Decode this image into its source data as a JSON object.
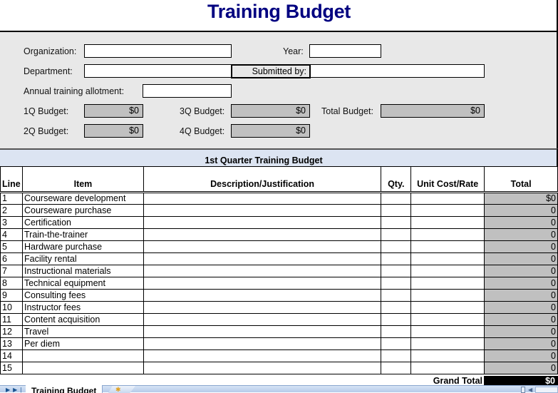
{
  "title": "Training Budget",
  "form": {
    "organization_label": "Organization:",
    "organization_value": "",
    "year_label": "Year:",
    "year_value": "",
    "department_label": "Department:",
    "department_value": "",
    "submitted_by_label": "Submitted by:",
    "submitted_by_value": "",
    "annual_allotment_label": "Annual training allotment:",
    "annual_allotment_value": "",
    "q1_label": "1Q Budget:",
    "q1_value": "$0",
    "q2_label": "2Q Budget:",
    "q2_value": "$0",
    "q3_label": "3Q Budget:",
    "q3_value": "$0",
    "q4_label": "4Q Budget:",
    "q4_value": "$0",
    "total_label": "Total Budget:",
    "total_value": "$0"
  },
  "quarter_section": {
    "title": "1st Quarter Training Budget",
    "columns": [
      "Line",
      "Item",
      "Description/Justification",
      "Qty.",
      "Unit Cost/Rate",
      "Total"
    ],
    "rows": [
      {
        "line": "1",
        "item": "Courseware development",
        "desc": "",
        "qty": "",
        "unit": "",
        "total": "$0"
      },
      {
        "line": "2",
        "item": "Courseware purchase",
        "desc": "",
        "qty": "",
        "unit": "",
        "total": "0"
      },
      {
        "line": "3",
        "item": "Certification",
        "desc": "",
        "qty": "",
        "unit": "",
        "total": "0"
      },
      {
        "line": "4",
        "item": "Train-the-trainer",
        "desc": "",
        "qty": "",
        "unit": "",
        "total": "0"
      },
      {
        "line": "5",
        "item": "Hardware purchase",
        "desc": "",
        "qty": "",
        "unit": "",
        "total": "0"
      },
      {
        "line": "6",
        "item": "Facility rental",
        "desc": "",
        "qty": "",
        "unit": "",
        "total": "0"
      },
      {
        "line": "7",
        "item": "Instructional materials",
        "desc": "",
        "qty": "",
        "unit": "",
        "total": "0"
      },
      {
        "line": "8",
        "item": "Technical equipment",
        "desc": "",
        "qty": "",
        "unit": "",
        "total": "0"
      },
      {
        "line": "9",
        "item": "Consulting fees",
        "desc": "",
        "qty": "",
        "unit": "",
        "total": "0"
      },
      {
        "line": "10",
        "item": "Instructor fees",
        "desc": "",
        "qty": "",
        "unit": "",
        "total": "0"
      },
      {
        "line": "11",
        "item": "Content acquisition",
        "desc": "",
        "qty": "",
        "unit": "",
        "total": "0"
      },
      {
        "line": "12",
        "item": "Travel",
        "desc": "",
        "qty": "",
        "unit": "",
        "total": "0"
      },
      {
        "line": "13",
        "item": "Per diem",
        "desc": "",
        "qty": "",
        "unit": "",
        "total": "0"
      },
      {
        "line": "14",
        "item": "",
        "desc": "",
        "qty": "",
        "unit": "",
        "total": "0"
      },
      {
        "line": "15",
        "item": "",
        "desc": "",
        "qty": "",
        "unit": "",
        "total": "0"
      }
    ],
    "grand_total_label": "Grand Total",
    "grand_total_value": "$0"
  },
  "sheet_tabs": {
    "active": "Training Budget",
    "nav_icons": [
      "next-sheet-icon",
      "last-sheet-icon"
    ],
    "new_sheet_icon": "insert-sheet-icon"
  },
  "colors": {
    "title": "#000080",
    "form_bg": "#e8e8e8",
    "calc_cell_bg": "#c0c0c0",
    "quarter_band_bg": "#dce4f2",
    "grand_total_bg": "#000000"
  }
}
